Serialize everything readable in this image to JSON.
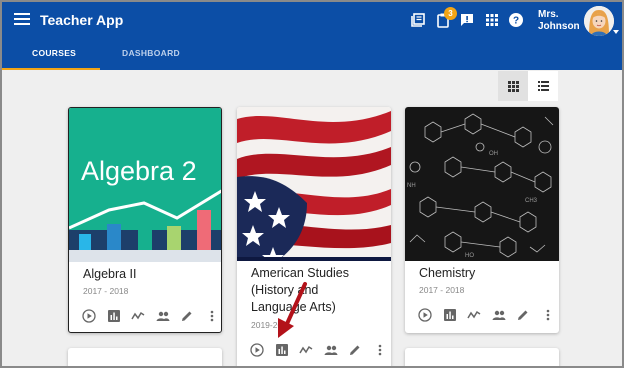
{
  "app": {
    "title": "Teacher App",
    "notification_count": "3"
  },
  "user": {
    "line1": "Mrs.",
    "line2": "Johnson"
  },
  "tabs": [
    {
      "label": "COURSES",
      "active": true
    },
    {
      "label": "DASHBOARD",
      "active": false
    }
  ],
  "view_toggle": {
    "active": "grid"
  },
  "courses": [
    {
      "title": "Algebra II",
      "year": "2017 - 2018",
      "cover_text": "Algebra 2"
    },
    {
      "title": "American Studies (History and Language Arts)",
      "title_lines": [
        "American Studies",
        "(History and",
        "Language Arts)"
      ],
      "year": "2019-202"
    },
    {
      "title": "Chemistry",
      "year": "2017 - 2018"
    }
  ],
  "card_actions": [
    "play-icon",
    "bar-chart-icon",
    "trend-icon",
    "people-icon",
    "edit-icon",
    "more-vert-icon"
  ],
  "colors": {
    "appbar": "#0c4ea6",
    "accent": "#f2a516",
    "background": "#efefef",
    "annotation_arrow": "#b3121a"
  }
}
